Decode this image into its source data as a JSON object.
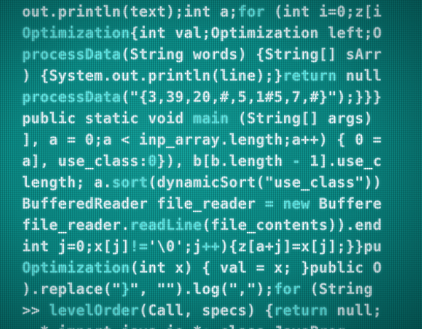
{
  "colors": {
    "plain": "#e6fbff",
    "keyword": "#5ff0ee",
    "background": "#0c8f8a"
  },
  "code_lines": [
    [
      {
        "t": "out.println(text);int a;",
        "k": "plain"
      },
      {
        "t": "for",
        "k": "keyword"
      },
      {
        "t": " (int i=0;z[i",
        "k": "plain"
      }
    ],
    [
      {
        "t": "Optimization",
        "k": "keyword"
      },
      {
        "t": "{int val;Optimization left;O",
        "k": "plain"
      }
    ],
    [
      {
        "t": "processData",
        "k": "keyword"
      },
      {
        "t": "(String words) {String[] sArr",
        "k": "plain"
      }
    ],
    [
      {
        "t": ") {System.out.println(line);}",
        "k": "plain"
      },
      {
        "t": "return",
        "k": "keyword"
      },
      {
        "t": " null",
        "k": "plain"
      }
    ],
    [
      {
        "t": "processData",
        "k": "keyword"
      },
      {
        "t": "(\"{3,39,20,#,5,1#5,7,#}\");}}}",
        "k": "plain"
      }
    ],
    [
      {
        "t": "public static void ",
        "k": "plain"
      },
      {
        "t": "main",
        "k": "keyword"
      },
      {
        "t": " (String[] args)",
        "k": "plain"
      }
    ],
    [
      {
        "t": "], a = 0;a < inp_array.length;a++) { 0 =",
        "k": "plain"
      }
    ],
    [
      {
        "t": "a], use_class:",
        "k": "plain"
      },
      {
        "t": "0",
        "k": "keyword"
      },
      {
        "t": "}), b[b.length ",
        "k": "plain"
      },
      {
        "t": "-",
        "k": "keyword"
      },
      {
        "t": " 1].use_c",
        "k": "plain"
      }
    ],
    [
      {
        "t": "length; a.",
        "k": "plain"
      },
      {
        "t": "sort",
        "k": "keyword"
      },
      {
        "t": "(dynamicSort(\"use_class\"))",
        "k": "plain"
      }
    ],
    [
      {
        "t": "BufferedReader file_reader ",
        "k": "plain"
      },
      {
        "t": "= new",
        "k": "keyword"
      },
      {
        "t": " Buffere",
        "k": "plain"
      }
    ],
    [
      {
        "t": "file_reader.",
        "k": "plain"
      },
      {
        "t": "readLine",
        "k": "keyword"
      },
      {
        "t": "(file_contents)).end",
        "k": "plain"
      }
    ],
    [
      {
        "t": "int j=0;x[j]",
        "k": "plain"
      },
      {
        "t": "!=",
        "k": "keyword"
      },
      {
        "t": "'\\0';j",
        "k": "plain"
      },
      {
        "t": "++",
        "k": "keyword"
      },
      {
        "t": "){z[a+j]=x[j];}}pu",
        "k": "plain"
      }
    ],
    [
      {
        "t": "Optimization",
        "k": "keyword"
      },
      {
        "t": "(int x) { val = x; }public O",
        "k": "plain"
      }
    ],
    [
      {
        "t": ").replace(\"",
        "k": "plain"
      },
      {
        "t": "}",
        "k": "keyword"
      },
      {
        "t": "\", \"\").log(\",\");",
        "k": "plain"
      },
      {
        "t": "for",
        "k": "keyword"
      },
      {
        "t": " (String",
        "k": "plain"
      }
    ],
    [
      {
        "t": ">> ",
        "k": "plain"
      },
      {
        "t": "levelOrder",
        "k": "keyword"
      },
      {
        "t": "(Call, specs) {",
        "k": "plain"
      },
      {
        "t": "return",
        "k": "keyword"
      },
      {
        "t": " null;",
        "k": "plain"
      }
    ],
    [
      {
        "t": "  * import java.io.*; class JavaProg",
        "k": "plain"
      }
    ]
  ]
}
